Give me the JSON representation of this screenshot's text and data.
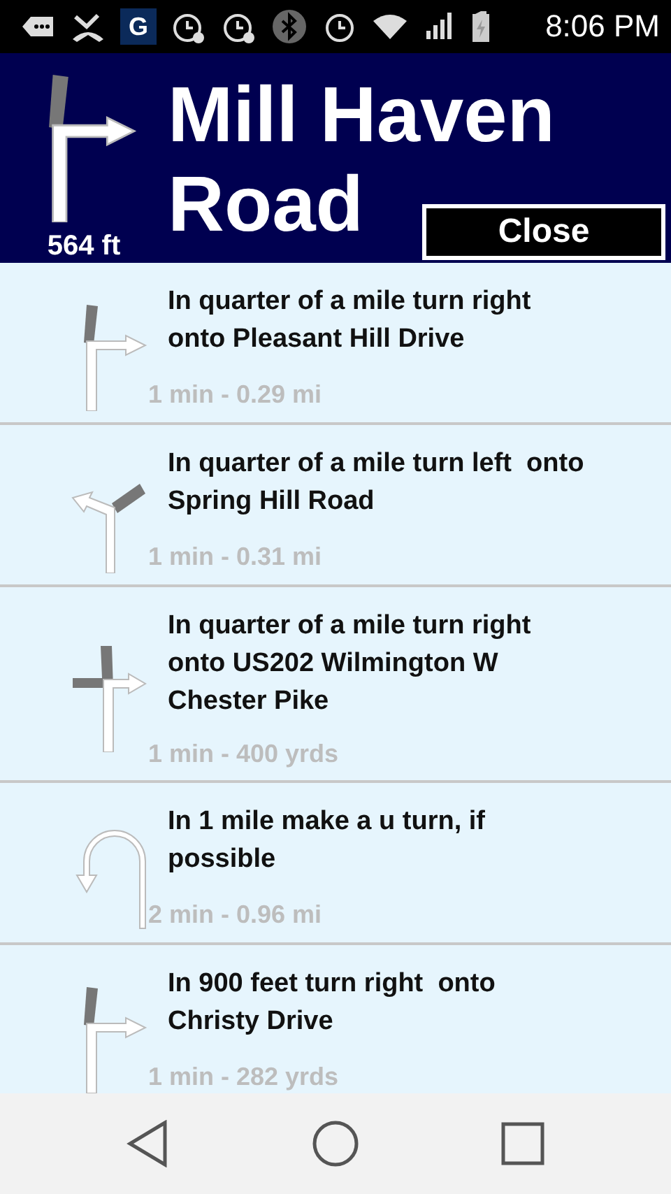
{
  "status_bar": {
    "time": "8:06 PM",
    "badge": "G"
  },
  "header": {
    "road_lines": [
      "Mill Haven",
      "Road"
    ],
    "distance": "564 ft",
    "kind": "right",
    "close_button": "Close"
  },
  "steps": [
    {
      "kind": "right",
      "instruction": "In quarter of a mile turn right onto Pleasant Hill Drive",
      "meta": "1 min - 0.29 mi"
    },
    {
      "kind": "left",
      "instruction": "In quarter of a mile turn left  onto Spring Hill Road",
      "meta": "1 min - 0.31 mi"
    },
    {
      "kind": "cross-right",
      "instruction": "In quarter of a mile turn right onto US202 Wilmington W Chester Pike",
      "meta": "1 min - 400 yrds"
    },
    {
      "kind": "uturn",
      "instruction": "In 1 mile make a u turn, if possible",
      "meta": "2 min - 0.96 mi"
    },
    {
      "kind": "right",
      "instruction": "In 900 feet turn right  onto Christy Drive",
      "meta": "1 min - 282 yrds"
    }
  ]
}
